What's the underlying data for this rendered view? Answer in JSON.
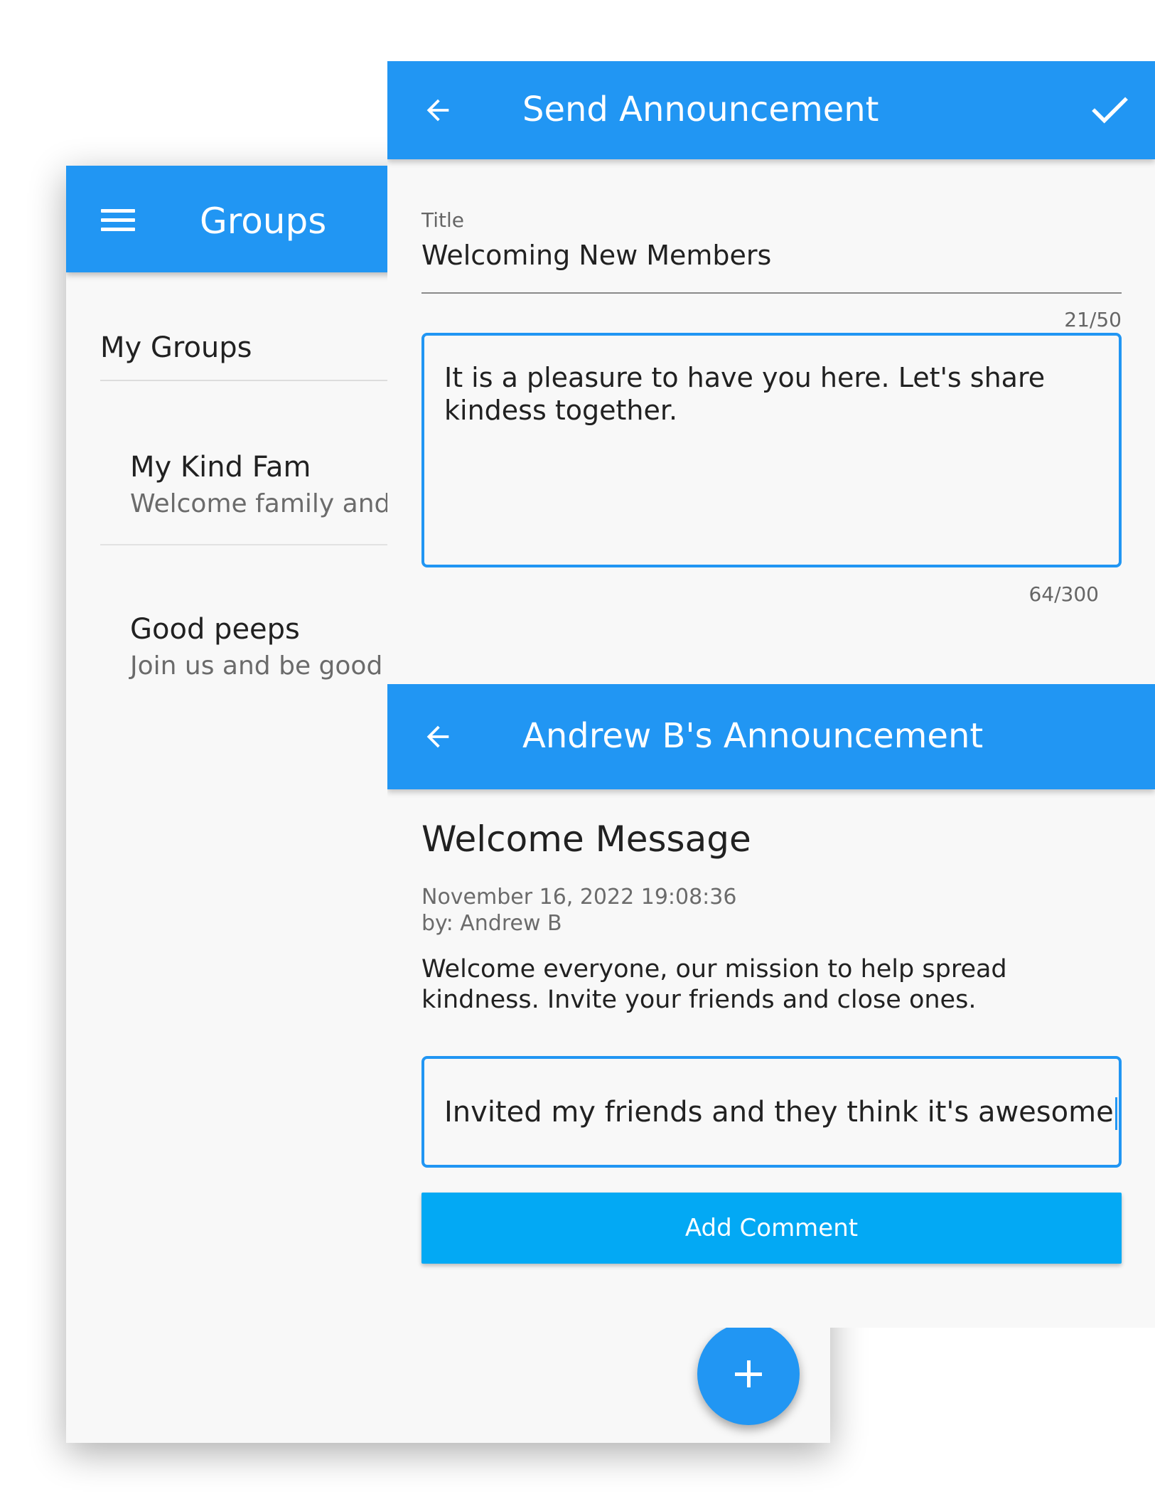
{
  "colors": {
    "primary": "#2196f3",
    "button": "#03a9f4",
    "background": "#f8f8f8",
    "text": "#212121",
    "secondary_text": "#6b6b6b"
  },
  "groups_screen": {
    "menu_icon": "hamburger-menu-icon",
    "title": "Groups",
    "section_header": "My Groups",
    "groups": [
      {
        "name": "My Kind Fam",
        "description": "Welcome family and fr"
      },
      {
        "name": "Good peeps",
        "description": "Join us and be good"
      }
    ],
    "fab_icon": "plus-icon"
  },
  "send_announcement": {
    "back_icon": "arrow-back-icon",
    "title": "Send Announcement",
    "confirm_icon": "check-icon",
    "title_field": {
      "label": "Title",
      "value": "Welcoming New Members",
      "counter": "21/50"
    },
    "body_field": {
      "value": "It is a pleasure to have you here. Let's share kindess together.",
      "counter": "64/300"
    }
  },
  "announcement_detail": {
    "back_icon": "arrow-back-icon",
    "title": "Andrew B's Announcement",
    "message_title": "Welcome Message",
    "date": "November 16, 2022 19:08:36",
    "author": "by: Andrew B",
    "body": "Welcome everyone, our mission to help spread kindness. Invite your friends and close ones.",
    "comment_value": "Invited my friends and they think it's awesome",
    "add_comment_label": "Add Comment"
  }
}
